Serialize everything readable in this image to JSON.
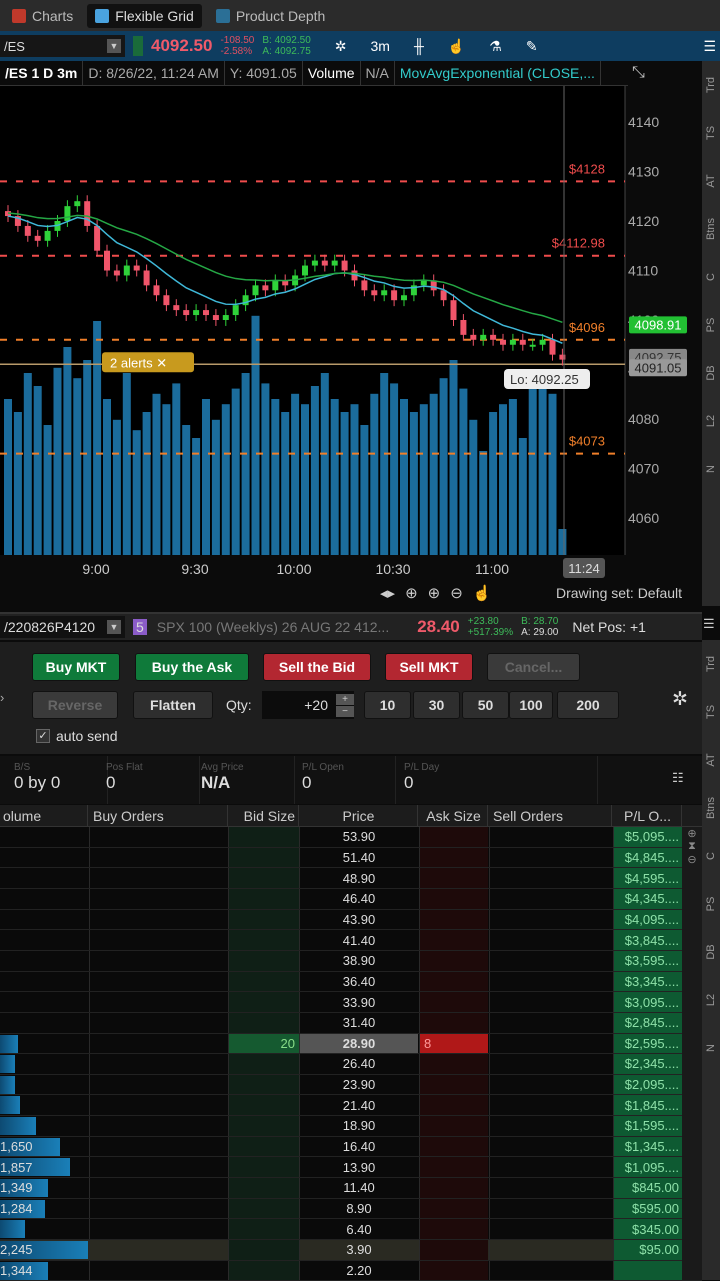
{
  "tabs": [
    {
      "label": "Charts"
    },
    {
      "label": "Flexible Grid"
    },
    {
      "label": "Product Depth"
    }
  ],
  "chart_header": {
    "symbol": "/ES",
    "last": "4092.50",
    "change": "-108.50",
    "change_pct": "-2.58%",
    "bid": "B: 4092.50",
    "ask": "A: 4092.75",
    "timeframe": "3m",
    "title": "/ES 1 D 3m",
    "date": "D: 8/26/22, 11:24 AM",
    "y": "Y: 4091.05",
    "volume_label": "Volume",
    "volume_value": "N/A",
    "study": "MovAvgExponential (CLOSE,..."
  },
  "chart_data": {
    "type": "candlestick",
    "ylim": [
      4055,
      4147
    ],
    "yticks": [
      4060,
      4070,
      4080,
      4090,
      4100,
      4110,
      4120,
      4130,
      4140
    ],
    "xticks": [
      "9:00",
      "9:30",
      "10:00",
      "10:30",
      "11:00"
    ],
    "cursor_time": "11:24",
    "closes": [
      4121,
      4119,
      4117,
      4116,
      4118,
      4120,
      4123,
      4124,
      4119,
      4114,
      4110,
      4109,
      4111,
      4110,
      4107,
      4105,
      4103,
      4102,
      4101,
      4102,
      4101,
      4100,
      4101,
      4103,
      4105,
      4107,
      4106,
      4108,
      4107,
      4109,
      4111,
      4112,
      4111,
      4112,
      4110,
      4108,
      4106,
      4105,
      4106,
      4104,
      4105,
      4107,
      4108,
      4106,
      4104,
      4100,
      4097,
      4096,
      4097,
      4096,
      4095,
      4096,
      4095,
      4095,
      4096,
      4093,
      4092
    ],
    "volumes": [
      60,
      55,
      70,
      65,
      50,
      72,
      80,
      68,
      75,
      90,
      60,
      52,
      70,
      48,
      55,
      62,
      58,
      66,
      50,
      45,
      60,
      52,
      58,
      64,
      70,
      92,
      66,
      60,
      55,
      62,
      58,
      65,
      70,
      60,
      55,
      58,
      50,
      62,
      70,
      66,
      60,
      55,
      58,
      62,
      68,
      75,
      64,
      52,
      40,
      55,
      58,
      60,
      45,
      70,
      66,
      62,
      10
    ],
    "levels": [
      {
        "label": "$4128",
        "value": 4128,
        "color": "#ef4c4c"
      },
      {
        "label": "$4112.98",
        "value": 4112.98,
        "color": "#ef4c4c"
      },
      {
        "label": "$4096",
        "value": 4096,
        "color": "#f07f2a"
      },
      {
        "label": "$4073",
        "value": 4073,
        "color": "#f07f2a"
      }
    ],
    "current_line": 4091.05,
    "axis_labels": [
      {
        "label": "4098.91",
        "value": 4098.91
      },
      {
        "label": "4092.75",
        "value": 4092.75
      },
      {
        "label": "4091.05",
        "value": 4091.05
      }
    ],
    "alerts_label": "2 alerts",
    "lo_label": "Lo: 4092.25"
  },
  "chart_footer": {
    "drawing_set": "Drawing set: Default"
  },
  "order": {
    "symbol": "/220826P4120",
    "link": "5",
    "description": "SPX 100 (Weeklys) 26 AUG 22 412...",
    "last": "28.40",
    "change": "+23.80",
    "change_pct": "+517.39%",
    "bid": "B: 28.70",
    "ask": "A: 29.00",
    "net_pos": "Net Pos: +1",
    "buttons": {
      "buy_mkt": "Buy MKT",
      "buy_ask": "Buy the Ask",
      "sell_bid": "Sell the Bid",
      "sell_mkt": "Sell MKT",
      "cancel": "Cancel...",
      "reverse": "Reverse",
      "flatten": "Flatten"
    },
    "qty_label": "Qty:",
    "qty": "+20",
    "qty_presets": [
      "10",
      "30",
      "50",
      "100",
      "200"
    ],
    "auto_send": "auto send",
    "stats": [
      {
        "label": "B/S",
        "value": "0 by 0"
      },
      {
        "label": "Pos Flat",
        "value": "0"
      },
      {
        "label": "Avg Price",
        "value": "N/A"
      },
      {
        "label": "P/L Open",
        "value": "0"
      },
      {
        "label": "P/L Day",
        "value": "0"
      }
    ]
  },
  "ladder": {
    "headers": [
      "olume",
      "Buy Orders",
      "Bid Size",
      "Price",
      "Ask Size",
      "Sell Orders",
      "P/L O..."
    ],
    "rows": [
      {
        "price": "53.90",
        "pl": "$5,095....",
        "vol": "",
        "vb": 0
      },
      {
        "price": "51.40",
        "pl": "$4,845....",
        "vol": "",
        "vb": 0
      },
      {
        "price": "48.90",
        "pl": "$4,595....",
        "vol": "",
        "vb": 0
      },
      {
        "price": "46.40",
        "pl": "$4,345....",
        "vol": "",
        "vb": 0
      },
      {
        "price": "43.90",
        "pl": "$4,095....",
        "vol": "",
        "vb": 0
      },
      {
        "price": "41.40",
        "pl": "$3,845....",
        "vol": "",
        "vb": 0
      },
      {
        "price": "38.90",
        "pl": "$3,595....",
        "vol": "",
        "vb": 0
      },
      {
        "price": "36.40",
        "pl": "$3,345....",
        "vol": "",
        "vb": 0
      },
      {
        "price": "33.90",
        "pl": "$3,095....",
        "vol": "",
        "vb": 0
      },
      {
        "price": "31.40",
        "pl": "$2,845....",
        "vol": "",
        "vb": 0
      },
      {
        "price": "28.90",
        "pl": "$2,595....",
        "vol": "",
        "vb": 18,
        "bid": "20",
        "ask": "8"
      },
      {
        "price": "26.40",
        "pl": "$2,345....",
        "vol": "",
        "vb": 15
      },
      {
        "price": "23.90",
        "pl": "$2,095....",
        "vol": "",
        "vb": 15
      },
      {
        "price": "21.40",
        "pl": "$1,845....",
        "vol": "",
        "vb": 20
      },
      {
        "price": "18.90",
        "pl": "$1,595....",
        "vol": "",
        "vb": 36
      },
      {
        "price": "16.40",
        "pl": "$1,345....",
        "vol": "1,650",
        "vb": 60
      },
      {
        "price": "13.90",
        "pl": "$1,095....",
        "vol": "1,857",
        "vb": 70
      },
      {
        "price": "11.40",
        "pl": "$845.00",
        "vol": "1,349",
        "vb": 48
      },
      {
        "price": "8.90",
        "pl": "$595.00",
        "vol": "1,284",
        "vb": 45
      },
      {
        "price": "6.40",
        "pl": "$345.00",
        "vol": "",
        "vb": 25
      },
      {
        "price": "3.90",
        "pl": "$95.00",
        "vol": "2,245",
        "vb": 88
      },
      {
        "price": "2.20",
        "pl": "",
        "vol": "1,344",
        "vb": 48
      }
    ]
  },
  "rail_top": [
    "Trd",
    "TS",
    "AT",
    "Btns",
    "C",
    "PS",
    "DB",
    "L2",
    "N"
  ],
  "rail_bottom": [
    "Trd",
    "TS",
    "AT",
    "Btns",
    "C",
    "PS",
    "DB",
    "L2",
    "N"
  ]
}
